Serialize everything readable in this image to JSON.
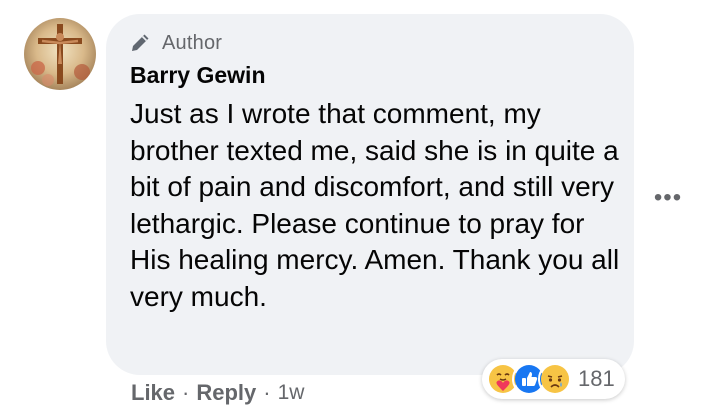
{
  "comment": {
    "author_badge": "Author",
    "name": "Barry Gewin",
    "text": "Just as I wrote that comment, my brother texted me, said she is in quite a bit of pain and discomfort, and still very lethargic. Please continue to pray for His healing mercy. Amen. Thank you all very much.",
    "more_label": "•••"
  },
  "reactions": {
    "icons": [
      "care-icon",
      "like-icon",
      "sad-icon"
    ],
    "count": "181"
  },
  "actions": {
    "like_label": "Like",
    "separator": "·",
    "reply_label": "Reply",
    "timestamp": "1w"
  },
  "colors": {
    "bubble": "#f0f2f5",
    "secondary_text": "#65676b",
    "primary_text": "#050505",
    "like_blue": "#1877f2",
    "reaction_yellow": "#f7c445"
  }
}
